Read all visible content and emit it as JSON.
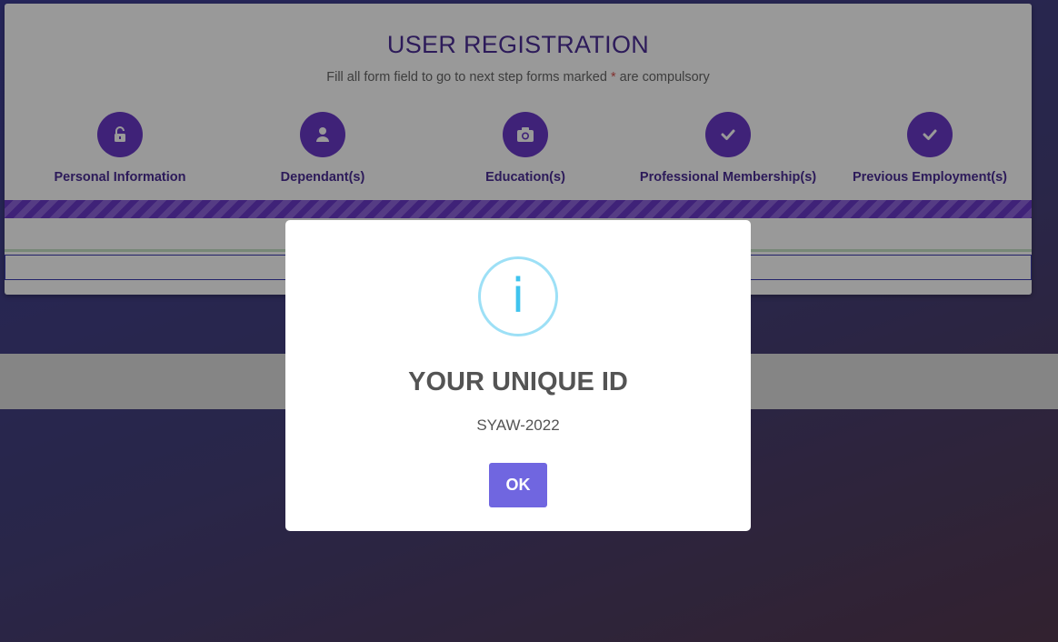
{
  "registration": {
    "title": "USER REGISTRATION",
    "subtitle_before": "Fill all form field to go to next step forms marked",
    "subtitle_required_mark": "*",
    "subtitle_after": "are compulsory",
    "steps": [
      {
        "label": "Personal Information",
        "icon": "unlock-icon"
      },
      {
        "label": "Dependant(s)",
        "icon": "user-icon"
      },
      {
        "label": "Education(s)",
        "icon": "camera-icon"
      },
      {
        "label": "Professional Membership(s)",
        "icon": "check-icon"
      },
      {
        "label": "Previous Employment(s)",
        "icon": "check-icon"
      }
    ],
    "progress_percent": 100
  },
  "modal": {
    "icon": "info-icon",
    "icon_glyph": "i",
    "title": "YOUR UNIQUE ID",
    "text": "SYAW-2022",
    "ok_label": "OK"
  },
  "colors": {
    "brand_purple": "#6a3ac8",
    "title_purple": "#4b2d96",
    "ok_button": "#7066e0",
    "info_icon": "#3fc3ee"
  }
}
